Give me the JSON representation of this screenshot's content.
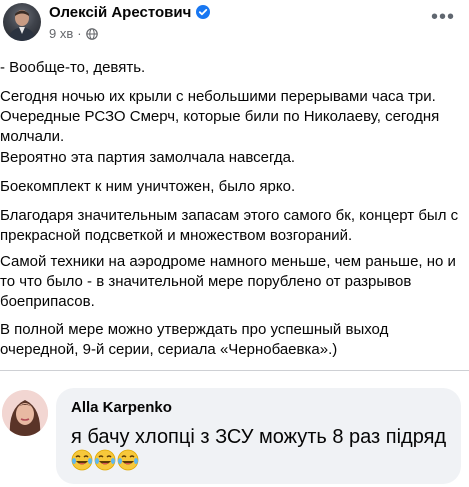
{
  "post": {
    "author": "Олексій Арестович",
    "time": "9 хв",
    "separator": "·",
    "more_label": "•••",
    "paragraphs": [
      "- Вообще-то, девять.",
      "Сегодня ночью их крыли с небольшими перерывами часа три. Очередные РСЗО Смерч, которые били по Николаеву, сегодня молчали.",
      "Вероятно эта партия замолчала навсегда.",
      "Боекомплект к ним уничтожен, было ярко.",
      "Благодаря значительным запасам этого самого бк, концерт был с прекрасной подсветкой и множеством возгораний.",
      "Самой техники на аэродроме намного меньше, чем раньше, но и то что было - в значительной мере порублено от разрывов боеприпасов.",
      "В полной мере можно утверждать про успешный выход очередной, 9-й серии, сериала «Чернобаевка».)"
    ]
  },
  "comment": {
    "author": "Alla Karpenko",
    "text": "я бачу хлопці з ЗСУ можуть 8 раз підряд",
    "emojis": [
      "laughing-crying-emoji",
      "laughing-crying-emoji",
      "laughing-crying-emoji"
    ]
  },
  "colors": {
    "verified_blue": "#1877f2",
    "meta_gray": "#65676b",
    "bubble_bg": "#f0f2f5",
    "emoji_yellow": "#f7c83b"
  }
}
